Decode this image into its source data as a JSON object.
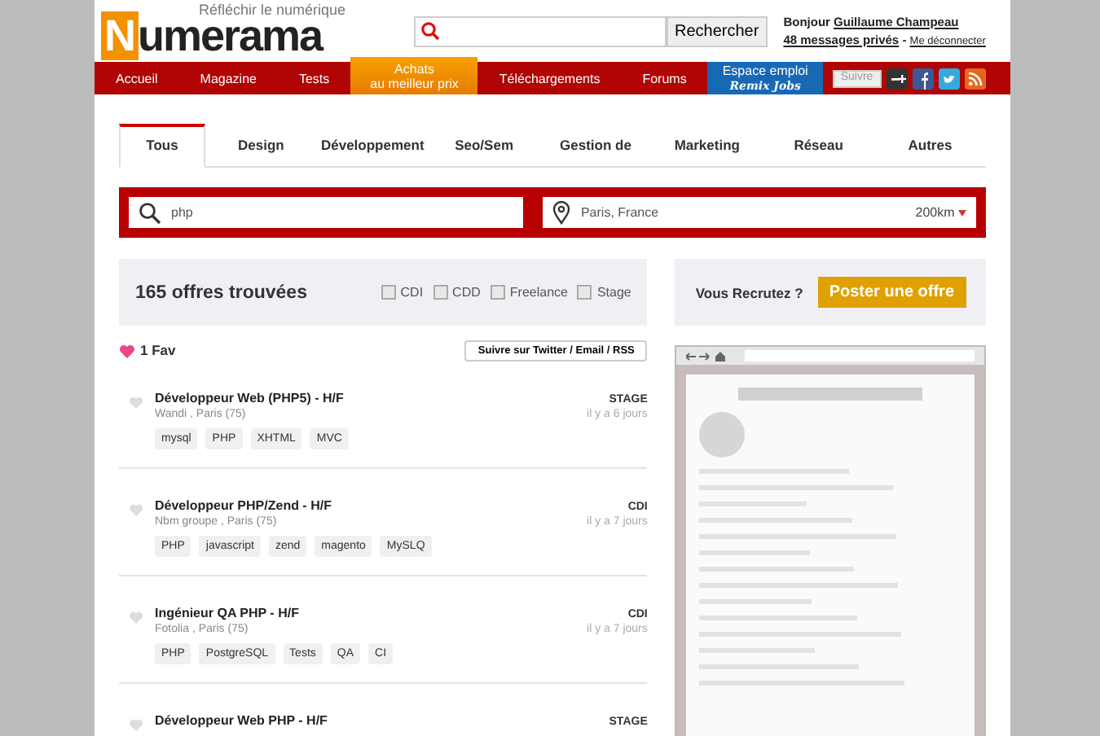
{
  "header": {
    "tagline": "Réfléchir le numérique",
    "logo_initial": "N",
    "logo_rest": "umerama",
    "search": {
      "button": "Rechercher"
    },
    "user": {
      "greeting": "Bonjour",
      "name": "Guillaume Champeau",
      "messages": "48 messages privés",
      "separator": "-",
      "logout": "Me déconnecter"
    }
  },
  "nav": [
    {
      "label": "Accueil",
      "kind": "plain"
    },
    {
      "label": "Magazine",
      "kind": "plain"
    },
    {
      "label": "Tests",
      "kind": "plain"
    },
    {
      "label": "Achats",
      "sublabel": "au meilleur prix",
      "kind": "promo"
    },
    {
      "label": "Téléchargements",
      "kind": "plain"
    },
    {
      "label": "Forums",
      "kind": "plain"
    },
    {
      "label": "Espace emploi",
      "sublabel": "Remix Jobs",
      "kind": "jobs"
    }
  ],
  "social": {
    "follow": "Suivre"
  },
  "tabs": [
    {
      "label": "Tous",
      "selected": true
    },
    {
      "label": "Design",
      "selected": false
    },
    {
      "label": "Développement",
      "selected": false
    },
    {
      "label": "Seo/Sem",
      "selected": false
    },
    {
      "label": "Gestion de",
      "selected": false
    },
    {
      "label": "Marketing",
      "selected": false
    },
    {
      "label": "Réseau",
      "selected": false
    },
    {
      "label": "Autres",
      "selected": false
    }
  ],
  "search": {
    "query": "php",
    "location": "Paris, France",
    "radius": "200km"
  },
  "results": {
    "count": "165 offres trouvées",
    "filters": [
      {
        "label": "CDI",
        "checked": false
      },
      {
        "label": "CDD",
        "checked": false
      },
      {
        "label": "Freelance",
        "checked": false
      },
      {
        "label": "Stage",
        "checked": false
      }
    ],
    "favs": "1 Fav",
    "follow_button": "Suivre sur Twitter / Email / RSS"
  },
  "jobs": [
    {
      "title": "Développeur Web (PHP5) - H/F",
      "company": "Wandi , Paris (75)",
      "type": "STAGE",
      "date": "il y a 6 jours",
      "favorite": false,
      "tags": [
        "mysql",
        "PHP",
        "XHTML",
        "MVC"
      ]
    },
    {
      "title": "Développeur PHP/Zend - H/F",
      "company": "Nbm groupe , Paris (75)",
      "type": "CDI",
      "date": "il y a 7 jours",
      "favorite": false,
      "tags": [
        "PHP",
        "javascript",
        "zend",
        "magento",
        "MySLQ"
      ]
    },
    {
      "title": "Ingénieur QA PHP - H/F",
      "company": "Fotolia , Paris (75)",
      "type": "CDI",
      "date": "il y a 7 jours",
      "favorite": false,
      "tags": [
        "PHP",
        "PostgreSQL",
        "Tests",
        "QA",
        "CI"
      ]
    },
    {
      "title": "Développeur Web PHP - H/F",
      "type": "STAGE",
      "favorite": false
    }
  ],
  "recruit": {
    "question": "Vous Recrutez ?",
    "button": "Poster une offre"
  }
}
